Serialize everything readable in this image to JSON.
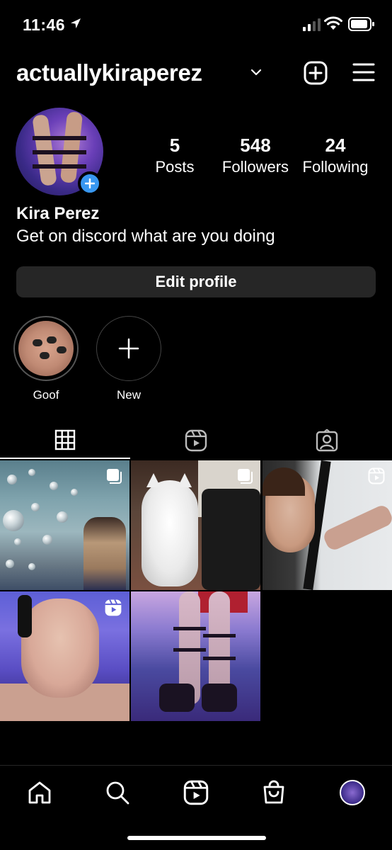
{
  "status_bar": {
    "time": "11:46"
  },
  "header": {
    "username": "actuallykiraperez"
  },
  "profile": {
    "full_name": "Kira Perez",
    "bio": "Get on discord what are you doing",
    "stats": [
      {
        "value": "5",
        "label": "Posts"
      },
      {
        "value": "548",
        "label": "Followers"
      },
      {
        "value": "24",
        "label": "Following"
      }
    ],
    "edit_button": "Edit profile"
  },
  "highlights": [
    {
      "label": "Goof"
    },
    {
      "label": "New"
    }
  ],
  "tabs": [
    {
      "icon": "grid-icon",
      "active": true
    },
    {
      "icon": "reels-icon",
      "active": false
    },
    {
      "icon": "tagged-icon",
      "active": false
    }
  ],
  "posts": [
    {
      "badge": "multi-photo-icon"
    },
    {
      "badge": "multi-photo-icon"
    },
    {
      "badge": "reels-icon"
    },
    {
      "badge": "reels-icon"
    },
    {
      "badge": ""
    }
  ],
  "bottom_nav": [
    {
      "icon": "home-icon"
    },
    {
      "icon": "search-icon"
    },
    {
      "icon": "reels-icon"
    },
    {
      "icon": "shop-icon"
    },
    {
      "icon": "profile-avatar"
    }
  ],
  "colors": {
    "background": "#000000",
    "button_bg": "#262626",
    "accent_blue": "#3897f0"
  }
}
